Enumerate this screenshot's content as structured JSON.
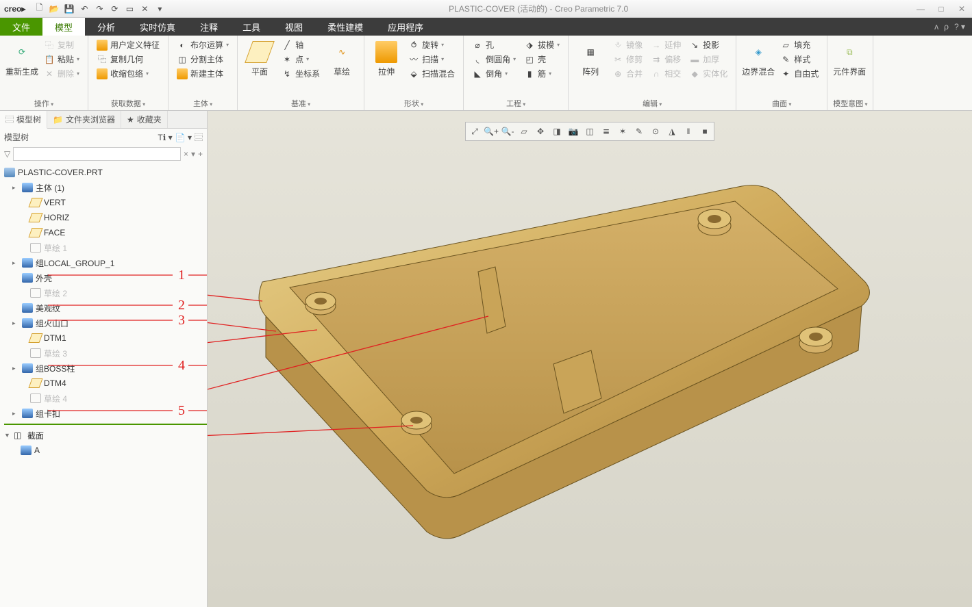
{
  "title": "PLASTIC-COVER (活动的) - Creo Parametric 7.0",
  "logo": "creo",
  "menu": {
    "file": "文件",
    "tabs": [
      "模型",
      "分析",
      "实时仿真",
      "注释",
      "工具",
      "视图",
      "柔性建模",
      "应用程序"
    ]
  },
  "ribbon": {
    "g_ops": {
      "label": "操作",
      "regen": "重新生成",
      "copy": "复制",
      "paste": "粘贴",
      "delete": "删除"
    },
    "g_data": {
      "label": "获取数据",
      "udf": "用户定义特征",
      "copygeom": "复制几何",
      "shrink": "收缩包络"
    },
    "g_body": {
      "label": "主体",
      "boolean": "布尔运算",
      "split": "分割主体",
      "new": "新建主体"
    },
    "g_datum": {
      "label": "基准",
      "plane": "平面",
      "axis": "轴",
      "point": "点",
      "csys": "坐标系",
      "sketch": "草绘"
    },
    "g_shape": {
      "label": "形状",
      "extrude": "拉伸",
      "revolve": "旋转",
      "sweep": "扫描",
      "blend": "扫描混合"
    },
    "g_eng": {
      "label": "工程",
      "hole": "孔",
      "round": "倒圆角",
      "chamfer": "倒角",
      "draft": "拔模",
      "shell": "壳",
      "rib": "筋"
    },
    "g_edit": {
      "label": "编辑",
      "pattern": "阵列",
      "mirror": "镜像",
      "trim": "修剪",
      "merge": "合并",
      "extend": "延伸",
      "offset": "偏移",
      "intersect": "相交",
      "thicken": "加厚",
      "solidify": "实体化",
      "project": "投影"
    },
    "g_surf": {
      "label": "曲面",
      "boundary": "边界混合",
      "fill": "填充",
      "style": "样式",
      "freestyle": "自由式"
    },
    "g_view": {
      "label": "模型意图",
      "cif": "元件界面"
    }
  },
  "side": {
    "tabs": {
      "tree": "模型树",
      "folder": "文件夹浏览器",
      "fav": "收藏夹"
    },
    "header": "模型树",
    "root": "PLASTIC-COVER.PRT",
    "items": [
      {
        "t": "主体 (1)",
        "k": "body",
        "arr": true,
        "ind": 1
      },
      {
        "t": "VERT",
        "k": "plane",
        "ind": 2
      },
      {
        "t": "HORIZ",
        "k": "plane",
        "ind": 2
      },
      {
        "t": "FACE",
        "k": "plane",
        "ind": 2
      },
      {
        "t": "草绘 1",
        "k": "sketch",
        "ind": 2,
        "dis": true
      },
      {
        "t": "组LOCAL_GROUP_1",
        "k": "grp",
        "arr": true,
        "ind": 1
      },
      {
        "t": "外壳",
        "k": "grp",
        "ind": 1,
        "ann": 1
      },
      {
        "t": "草绘 2",
        "k": "sketch",
        "ind": 2,
        "dis": true
      },
      {
        "t": "美观纹",
        "k": "grp",
        "ind": 1,
        "ann": 2
      },
      {
        "t": "组火山口",
        "k": "grp",
        "arr": true,
        "ind": 1,
        "ann": 3
      },
      {
        "t": "DTM1",
        "k": "plane",
        "ind": 2
      },
      {
        "t": "草绘 3",
        "k": "sketch",
        "ind": 2,
        "dis": true
      },
      {
        "t": "组BOSS柱",
        "k": "grp",
        "arr": true,
        "ind": 1,
        "ann": 4
      },
      {
        "t": "DTM4",
        "k": "plane",
        "ind": 2
      },
      {
        "t": "草绘 4",
        "k": "sketch",
        "ind": 2,
        "dis": true
      },
      {
        "t": "组卡扣",
        "k": "grp",
        "arr": true,
        "ind": 1,
        "ann": 5
      }
    ],
    "section_hdr": "截面",
    "section_item": "A"
  },
  "annotations": [
    "1",
    "2",
    "3",
    "4",
    "5"
  ]
}
